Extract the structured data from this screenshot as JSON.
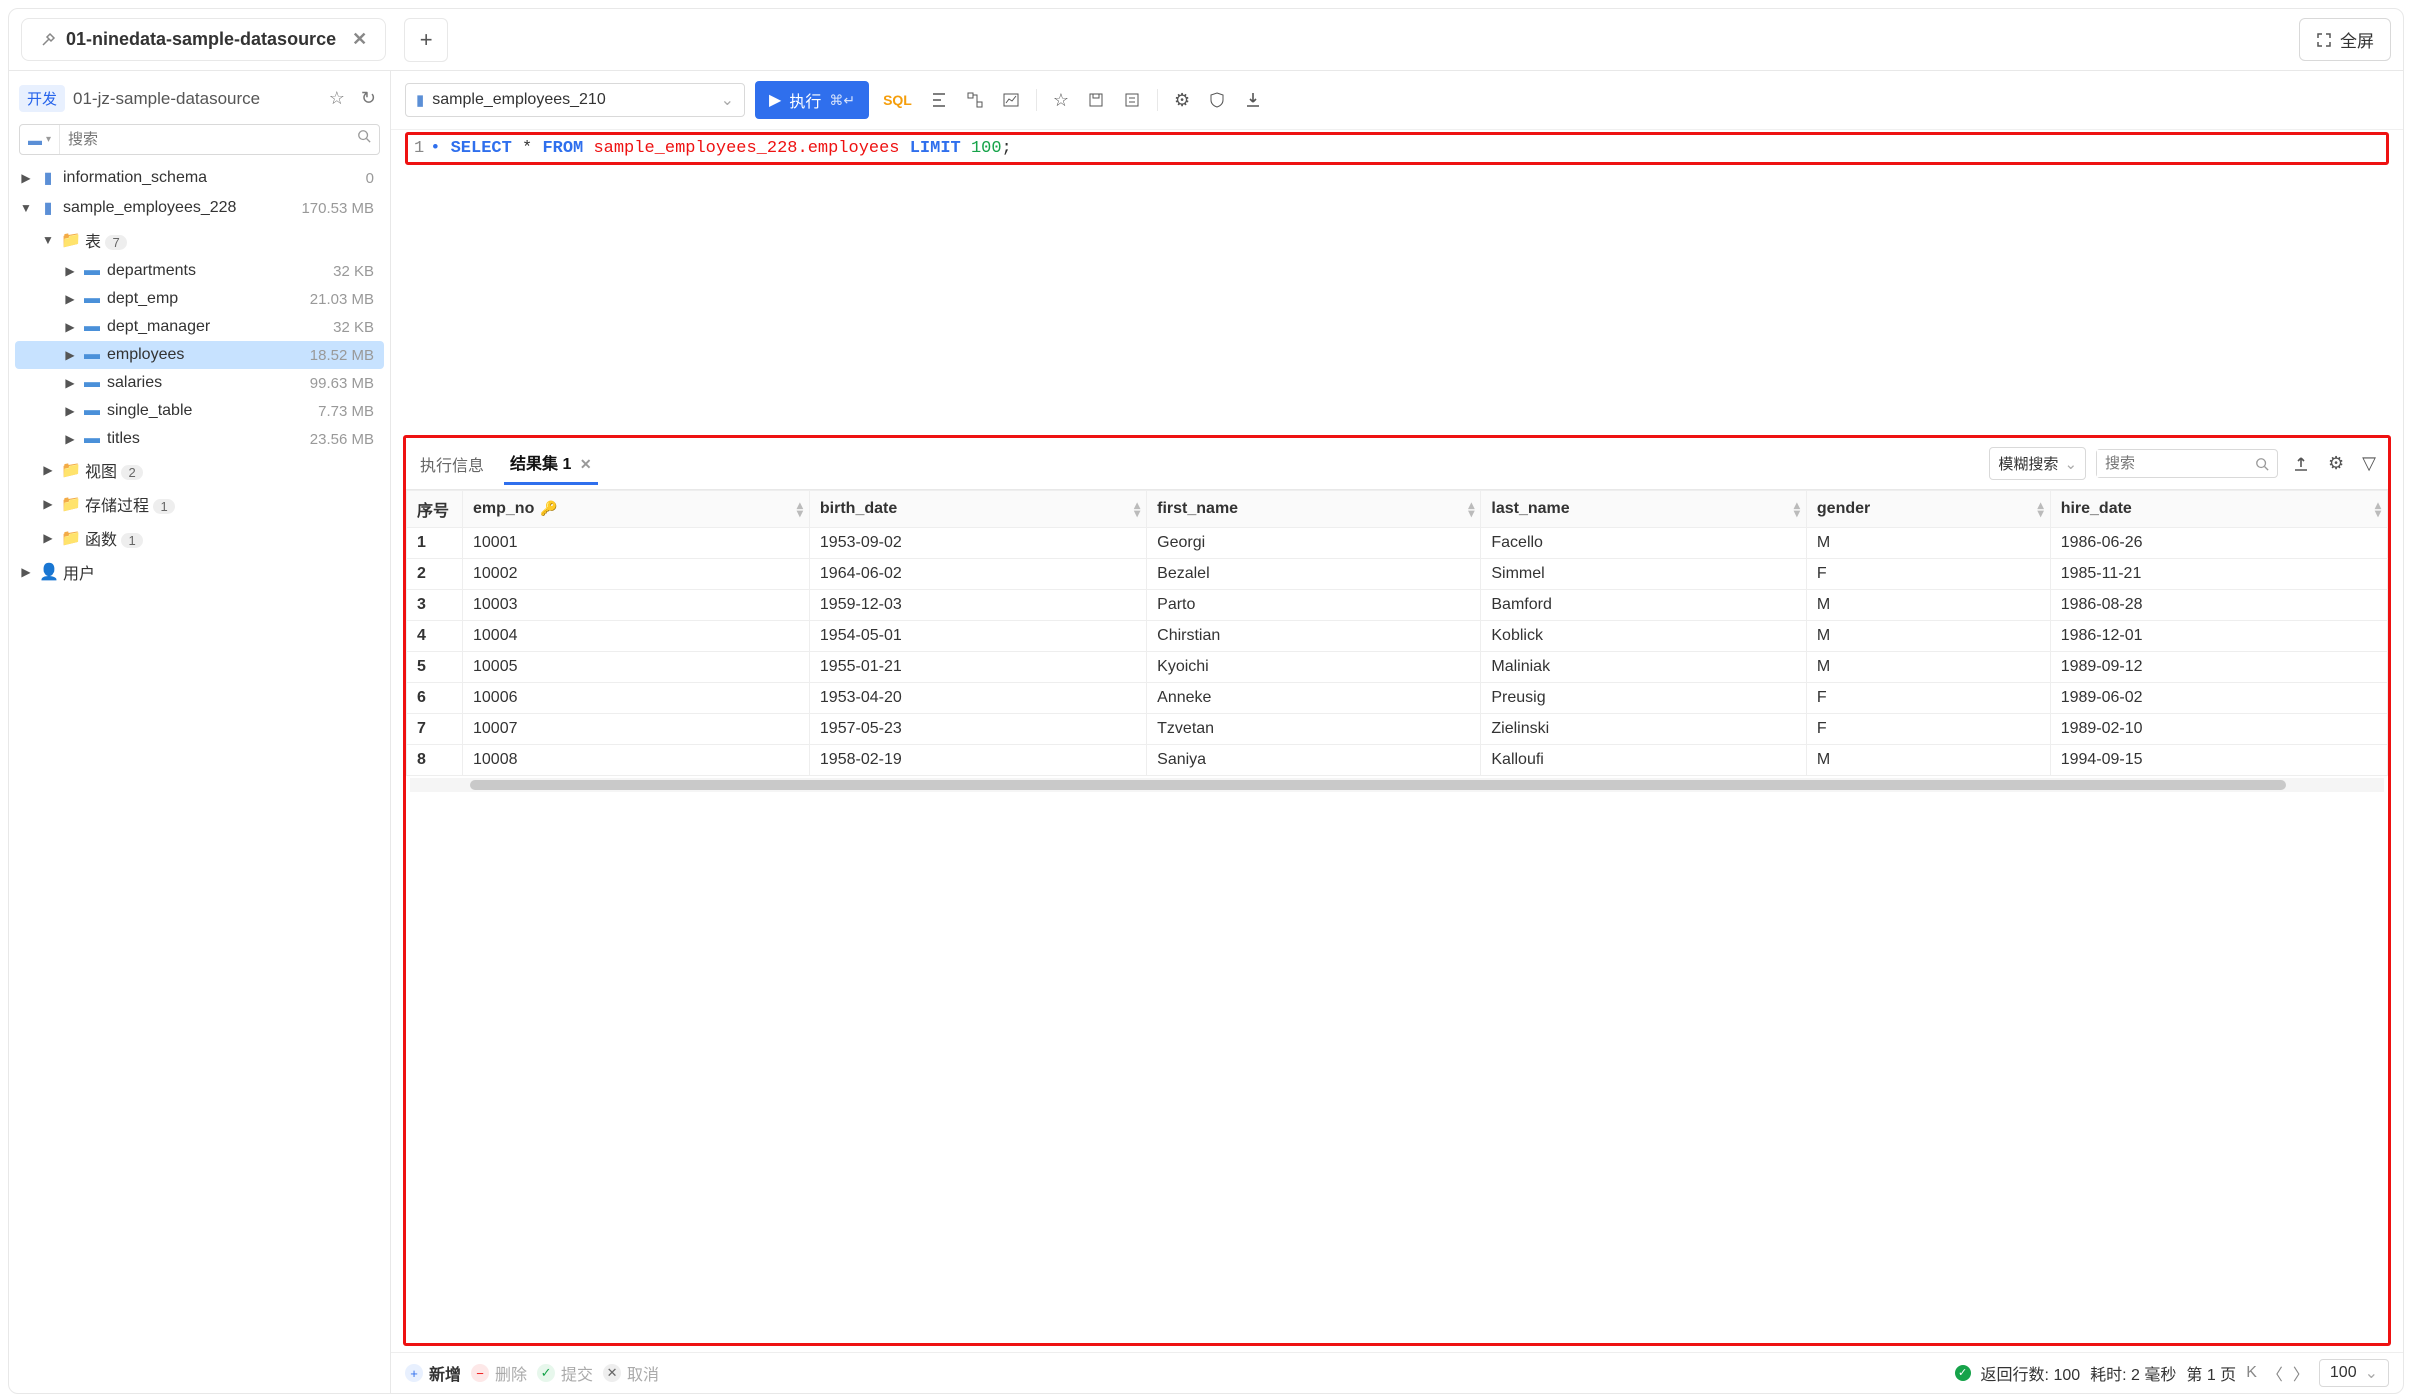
{
  "tab": {
    "title": "01-ninedata-sample-datasource"
  },
  "newTabPlus": "+",
  "fullscreen": "全屏",
  "sidebar": {
    "envBadge": "开发",
    "datasource": "01-jz-sample-datasource",
    "searchPlaceholder": "搜索",
    "tree": {
      "db0": {
        "label": "information_schema",
        "meta": "0"
      },
      "db1": {
        "label": "sample_employees_228",
        "meta": "170.53 MB"
      },
      "tablesFolder": {
        "label": "表",
        "count": "7"
      },
      "tables": {
        "t0": {
          "label": "departments",
          "meta": "32 KB"
        },
        "t1": {
          "label": "dept_emp",
          "meta": "21.03 MB"
        },
        "t2": {
          "label": "dept_manager",
          "meta": "32 KB"
        },
        "t3": {
          "label": "employees",
          "meta": "18.52 MB"
        },
        "t4": {
          "label": "salaries",
          "meta": "99.63 MB"
        },
        "t5": {
          "label": "single_table",
          "meta": "7.73 MB"
        },
        "t6": {
          "label": "titles",
          "meta": "23.56 MB"
        }
      },
      "views": {
        "label": "视图",
        "count": "2"
      },
      "procs": {
        "label": "存储过程",
        "count": "1"
      },
      "funcs": {
        "label": "函数",
        "count": "1"
      },
      "users": {
        "label": "用户"
      }
    }
  },
  "toolbar": {
    "dbSelected": "sample_employees_210",
    "runLabel": "执行",
    "runKbd": "⌘↵",
    "sqlLabel": "SQL"
  },
  "editor": {
    "lineNo": "1",
    "kw_select": "SELECT",
    "star": "*",
    "kw_from": "FROM",
    "table": "sample_employees_228.employees",
    "kw_limit": "LIMIT",
    "limit_n": "100",
    "semicolon": ";"
  },
  "results": {
    "tabExecInfo": "执行信息",
    "tabResult": "结果集 1",
    "fuzzyLabel": "模糊搜索",
    "searchPlaceholder": "搜索",
    "columns": {
      "rownum": "序号",
      "c0": "emp_no",
      "c1": "birth_date",
      "c2": "first_name",
      "c3": "last_name",
      "c4": "gender",
      "c5": "hire_date"
    },
    "rows": [
      {
        "n": "1",
        "c0": "10001",
        "c1": "1953-09-02",
        "c2": "Georgi",
        "c3": "Facello",
        "c4": "M",
        "c5": "1986-06-26"
      },
      {
        "n": "2",
        "c0": "10002",
        "c1": "1964-06-02",
        "c2": "Bezalel",
        "c3": "Simmel",
        "c4": "F",
        "c5": "1985-11-21"
      },
      {
        "n": "3",
        "c0": "10003",
        "c1": "1959-12-03",
        "c2": "Parto",
        "c3": "Bamford",
        "c4": "M",
        "c5": "1986-08-28"
      },
      {
        "n": "4",
        "c0": "10004",
        "c1": "1954-05-01",
        "c2": "Chirstian",
        "c3": "Koblick",
        "c4": "M",
        "c5": "1986-12-01"
      },
      {
        "n": "5",
        "c0": "10005",
        "c1": "1955-01-21",
        "c2": "Kyoichi",
        "c3": "Maliniak",
        "c4": "M",
        "c5": "1989-09-12"
      },
      {
        "n": "6",
        "c0": "10006",
        "c1": "1953-04-20",
        "c2": "Anneke",
        "c3": "Preusig",
        "c4": "F",
        "c5": "1989-06-02"
      },
      {
        "n": "7",
        "c0": "10007",
        "c1": "1957-05-23",
        "c2": "Tzvetan",
        "c3": "Zielinski",
        "c4": "F",
        "c5": "1989-02-10"
      },
      {
        "n": "8",
        "c0": "10008",
        "c1": "1958-02-19",
        "c2": "Saniya",
        "c3": "Kalloufi",
        "c4": "M",
        "c5": "1994-09-15"
      }
    ]
  },
  "footer": {
    "add": "新增",
    "del": "删除",
    "commit": "提交",
    "cancel": "取消",
    "returnedRows": "返回行数: 100",
    "elapsed": "耗时: 2 毫秒",
    "page": "第 1 页",
    "pageSize": "100"
  }
}
